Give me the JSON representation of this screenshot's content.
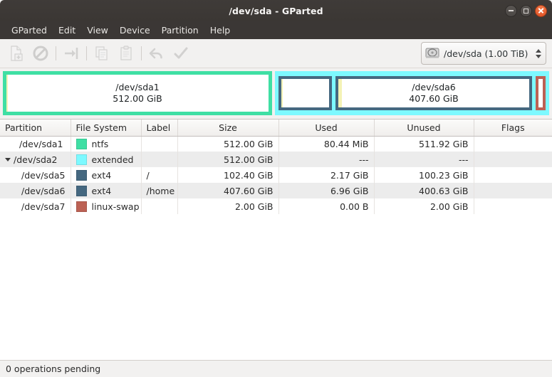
{
  "window": {
    "title": "/dev/sda - GParted",
    "controls": [
      {
        "name": "minimize",
        "label": "Minimize"
      },
      {
        "name": "maximize",
        "label": "Maximize"
      },
      {
        "name": "close",
        "label": "Close"
      }
    ]
  },
  "menubar": {
    "items": [
      {
        "label": "GParted"
      },
      {
        "label": "Edit"
      },
      {
        "label": "View"
      },
      {
        "label": "Device"
      },
      {
        "label": "Partition"
      },
      {
        "label": "Help"
      }
    ]
  },
  "toolbar": {
    "buttons": [
      {
        "icon": "new-partition-icon",
        "label": "New",
        "enabled": false
      },
      {
        "icon": "delete-partition-icon",
        "label": "Delete",
        "enabled": false
      },
      {
        "icon": "resize-move-icon",
        "label": "Resize/Move",
        "enabled": false
      },
      {
        "icon": "copy-icon",
        "label": "Copy",
        "enabled": false
      },
      {
        "icon": "paste-icon",
        "label": "Paste",
        "enabled": false
      },
      {
        "icon": "undo-icon",
        "label": "Undo",
        "enabled": false
      },
      {
        "icon": "apply-icon",
        "label": "Apply",
        "enabled": false
      }
    ],
    "device_selector": {
      "icon": "hard-disk-icon",
      "device": "/dev/sda",
      "size": "(1.00 TiB)",
      "value": "/dev/sda  (1.00 TiB)"
    }
  },
  "disk_graphic": {
    "partitions": [
      {
        "name": "/dev/sda1",
        "size": "512.00 GiB",
        "fs": "ntfs",
        "border_color": "#3fdfa4",
        "used_color": "#f4f2b5",
        "used_fraction": 0.0002,
        "show_label": true
      },
      {
        "name": "/dev/sda2",
        "size": "512.00 GiB",
        "fs": "extended",
        "border_color": "#7df9ff",
        "show_label": false,
        "children": [
          {
            "name": "/dev/sda5",
            "size": "102.40 GiB",
            "fs": "ext4",
            "border_color": "#456880",
            "used_color": "#f4f2b5",
            "used_fraction": 0.021,
            "show_label": false
          },
          {
            "name": "/dev/sda6",
            "size": "407.60 GiB",
            "fs": "ext4",
            "border_color": "#456880",
            "used_color": "#f4f2b5",
            "used_fraction": 0.017,
            "show_label": true
          },
          {
            "name": "/dev/sda7",
            "size": "2.00 GiB",
            "fs": "linux-swap",
            "border_color": "#bc6154",
            "used_color": "#ffffff",
            "used_fraction": 0,
            "show_label": false
          }
        ]
      }
    ]
  },
  "table": {
    "columns": [
      {
        "key": "partition",
        "label": "Partition",
        "align": "left"
      },
      {
        "key": "filesystem",
        "label": "File System",
        "align": "left"
      },
      {
        "key": "label",
        "label": "Label",
        "align": "left"
      },
      {
        "key": "size",
        "label": "Size",
        "align": "right"
      },
      {
        "key": "used",
        "label": "Used",
        "align": "right"
      },
      {
        "key": "unused",
        "label": "Unused",
        "align": "right"
      },
      {
        "key": "flags",
        "label": "Flags",
        "align": "left"
      }
    ],
    "rows": [
      {
        "partition": "/dev/sda1",
        "filesystem": "ntfs",
        "fs_color": "#3fdfa4",
        "label": "",
        "size": "512.00 GiB",
        "used": "80.44 MiB",
        "unused": "511.92 GiB",
        "flags": "",
        "indent": 0,
        "expander": false,
        "alt": false
      },
      {
        "partition": "/dev/sda2",
        "filesystem": "extended",
        "fs_color": "#7df9ff",
        "label": "",
        "size": "512.00 GiB",
        "used": "---",
        "unused": "---",
        "flags": "",
        "indent": 0,
        "expander": true,
        "alt": true
      },
      {
        "partition": "/dev/sda5",
        "filesystem": "ext4",
        "fs_color": "#456880",
        "label": "/",
        "size": "102.40 GiB",
        "used": "2.17 GiB",
        "unused": "100.23 GiB",
        "flags": "",
        "indent": 1,
        "expander": false,
        "alt": false
      },
      {
        "partition": "/dev/sda6",
        "filesystem": "ext4",
        "fs_color": "#456880",
        "label": "/home",
        "size": "407.60 GiB",
        "used": "6.96 GiB",
        "unused": "400.63 GiB",
        "flags": "",
        "indent": 1,
        "expander": false,
        "alt": true
      },
      {
        "partition": "/dev/sda7",
        "filesystem": "linux-swap",
        "fs_color": "#bc6154",
        "label": "",
        "size": "2.00 GiB",
        "used": "0.00 B",
        "unused": "2.00 GiB",
        "flags": "",
        "indent": 1,
        "expander": false,
        "alt": false
      }
    ]
  },
  "statusbar": {
    "text": "0 operations pending"
  }
}
